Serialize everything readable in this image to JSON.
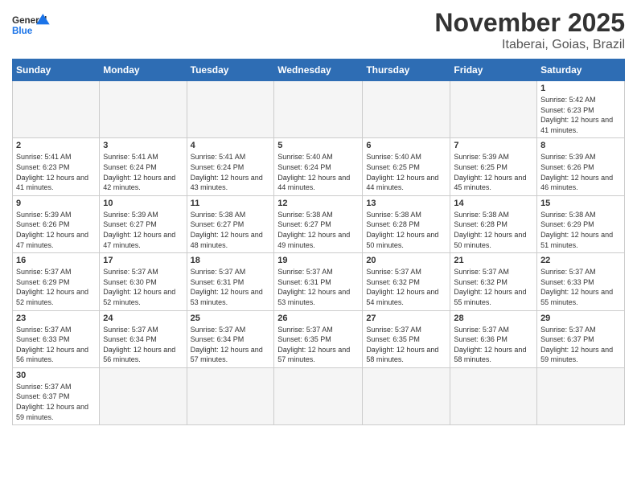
{
  "header": {
    "logo_general": "General",
    "logo_blue": "Blue",
    "month_title": "November 2025",
    "location": "Itaberai, Goias, Brazil"
  },
  "days_of_week": [
    "Sunday",
    "Monday",
    "Tuesday",
    "Wednesday",
    "Thursday",
    "Friday",
    "Saturday"
  ],
  "weeks": [
    [
      {
        "day": "",
        "info": ""
      },
      {
        "day": "",
        "info": ""
      },
      {
        "day": "",
        "info": ""
      },
      {
        "day": "",
        "info": ""
      },
      {
        "day": "",
        "info": ""
      },
      {
        "day": "",
        "info": ""
      },
      {
        "day": "1",
        "info": "Sunrise: 5:42 AM\nSunset: 6:23 PM\nDaylight: 12 hours and 41 minutes."
      }
    ],
    [
      {
        "day": "2",
        "info": "Sunrise: 5:41 AM\nSunset: 6:23 PM\nDaylight: 12 hours and 41 minutes."
      },
      {
        "day": "3",
        "info": "Sunrise: 5:41 AM\nSunset: 6:24 PM\nDaylight: 12 hours and 42 minutes."
      },
      {
        "day": "4",
        "info": "Sunrise: 5:41 AM\nSunset: 6:24 PM\nDaylight: 12 hours and 43 minutes."
      },
      {
        "day": "5",
        "info": "Sunrise: 5:40 AM\nSunset: 6:24 PM\nDaylight: 12 hours and 44 minutes."
      },
      {
        "day": "6",
        "info": "Sunrise: 5:40 AM\nSunset: 6:25 PM\nDaylight: 12 hours and 44 minutes."
      },
      {
        "day": "7",
        "info": "Sunrise: 5:39 AM\nSunset: 6:25 PM\nDaylight: 12 hours and 45 minutes."
      },
      {
        "day": "8",
        "info": "Sunrise: 5:39 AM\nSunset: 6:26 PM\nDaylight: 12 hours and 46 minutes."
      }
    ],
    [
      {
        "day": "9",
        "info": "Sunrise: 5:39 AM\nSunset: 6:26 PM\nDaylight: 12 hours and 47 minutes."
      },
      {
        "day": "10",
        "info": "Sunrise: 5:39 AM\nSunset: 6:27 PM\nDaylight: 12 hours and 47 minutes."
      },
      {
        "day": "11",
        "info": "Sunrise: 5:38 AM\nSunset: 6:27 PM\nDaylight: 12 hours and 48 minutes."
      },
      {
        "day": "12",
        "info": "Sunrise: 5:38 AM\nSunset: 6:27 PM\nDaylight: 12 hours and 49 minutes."
      },
      {
        "day": "13",
        "info": "Sunrise: 5:38 AM\nSunset: 6:28 PM\nDaylight: 12 hours and 50 minutes."
      },
      {
        "day": "14",
        "info": "Sunrise: 5:38 AM\nSunset: 6:28 PM\nDaylight: 12 hours and 50 minutes."
      },
      {
        "day": "15",
        "info": "Sunrise: 5:38 AM\nSunset: 6:29 PM\nDaylight: 12 hours and 51 minutes."
      }
    ],
    [
      {
        "day": "16",
        "info": "Sunrise: 5:37 AM\nSunset: 6:29 PM\nDaylight: 12 hours and 52 minutes."
      },
      {
        "day": "17",
        "info": "Sunrise: 5:37 AM\nSunset: 6:30 PM\nDaylight: 12 hours and 52 minutes."
      },
      {
        "day": "18",
        "info": "Sunrise: 5:37 AM\nSunset: 6:31 PM\nDaylight: 12 hours and 53 minutes."
      },
      {
        "day": "19",
        "info": "Sunrise: 5:37 AM\nSunset: 6:31 PM\nDaylight: 12 hours and 53 minutes."
      },
      {
        "day": "20",
        "info": "Sunrise: 5:37 AM\nSunset: 6:32 PM\nDaylight: 12 hours and 54 minutes."
      },
      {
        "day": "21",
        "info": "Sunrise: 5:37 AM\nSunset: 6:32 PM\nDaylight: 12 hours and 55 minutes."
      },
      {
        "day": "22",
        "info": "Sunrise: 5:37 AM\nSunset: 6:33 PM\nDaylight: 12 hours and 55 minutes."
      }
    ],
    [
      {
        "day": "23",
        "info": "Sunrise: 5:37 AM\nSunset: 6:33 PM\nDaylight: 12 hours and 56 minutes."
      },
      {
        "day": "24",
        "info": "Sunrise: 5:37 AM\nSunset: 6:34 PM\nDaylight: 12 hours and 56 minutes."
      },
      {
        "day": "25",
        "info": "Sunrise: 5:37 AM\nSunset: 6:34 PM\nDaylight: 12 hours and 57 minutes."
      },
      {
        "day": "26",
        "info": "Sunrise: 5:37 AM\nSunset: 6:35 PM\nDaylight: 12 hours and 57 minutes."
      },
      {
        "day": "27",
        "info": "Sunrise: 5:37 AM\nSunset: 6:35 PM\nDaylight: 12 hours and 58 minutes."
      },
      {
        "day": "28",
        "info": "Sunrise: 5:37 AM\nSunset: 6:36 PM\nDaylight: 12 hours and 58 minutes."
      },
      {
        "day": "29",
        "info": "Sunrise: 5:37 AM\nSunset: 6:37 PM\nDaylight: 12 hours and 59 minutes."
      }
    ],
    [
      {
        "day": "30",
        "info": "Sunrise: 5:37 AM\nSunset: 6:37 PM\nDaylight: 12 hours and 59 minutes."
      },
      {
        "day": "",
        "info": ""
      },
      {
        "day": "",
        "info": ""
      },
      {
        "day": "",
        "info": ""
      },
      {
        "day": "",
        "info": ""
      },
      {
        "day": "",
        "info": ""
      },
      {
        "day": "",
        "info": ""
      }
    ]
  ]
}
